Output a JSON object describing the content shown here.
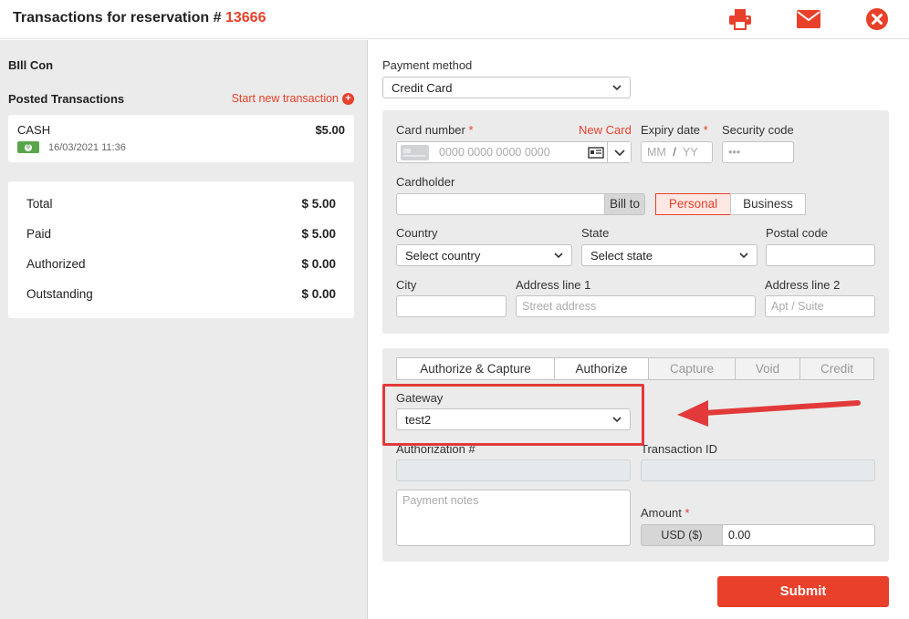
{
  "header": {
    "title_prefix": "Transactions for reservation #",
    "reservation_number": "13666"
  },
  "left": {
    "guest_name": "BIll Con",
    "posted_title": "Posted Transactions",
    "start_new_label": "Start new transaction",
    "transaction": {
      "method": "CASH",
      "amount": "$5.00",
      "date": "16/03/2021 11:36"
    },
    "summary": [
      {
        "label": "Total",
        "value": "$ 5.00"
      },
      {
        "label": "Paid",
        "value": "$ 5.00"
      },
      {
        "label": "Authorized",
        "value": "$ 0.00"
      },
      {
        "label": "Outstanding",
        "value": "$ 0.00"
      }
    ]
  },
  "form": {
    "payment_method_label": "Payment method",
    "payment_method_value": "Credit Card",
    "card_number_label": "Card number",
    "new_card_label": "New Card",
    "card_number_placeholder": "0000 0000 0000 0000",
    "expiry_label": "Expiry date",
    "expiry_mm": "MM",
    "expiry_sep": "/",
    "expiry_yy": "YY",
    "security_label": "Security code",
    "security_placeholder": "•••",
    "cardholder_label": "Cardholder",
    "bill_to_label": "Bill to",
    "personal_label": "Personal",
    "business_label": "Business",
    "country_label": "Country",
    "country_value": "Select country",
    "state_label": "State",
    "state_value": "Select state",
    "postal_label": "Postal code",
    "city_label": "City",
    "address1_label": "Address line 1",
    "address1_placeholder": "Street address",
    "address2_label": "Address line 2",
    "address2_placeholder": "Apt / Suite",
    "required_mark": "*"
  },
  "tabs": [
    {
      "label": "Authorize & Capture",
      "enabled": true
    },
    {
      "label": "Authorize",
      "enabled": true
    },
    {
      "label": "Capture",
      "enabled": false
    },
    {
      "label": "Void",
      "enabled": false
    },
    {
      "label": "Credit",
      "enabled": false
    }
  ],
  "gateway": {
    "gateway_label": "Gateway",
    "gateway_value": "test2",
    "auth_label": "Authorization #",
    "transaction_id_label": "Transaction ID",
    "notes_placeholder": "Payment notes",
    "amount_label": "Amount",
    "currency": "USD ($)",
    "amount_value": "0.00"
  },
  "submit_label": "Submit",
  "colors": {
    "accent": "#e8402a",
    "cash": "#5aa54a",
    "panel": "#ebebeb"
  }
}
